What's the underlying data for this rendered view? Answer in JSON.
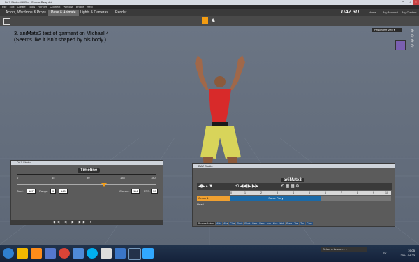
{
  "window": {
    "title": "DAZ Studio 4.6 Pro - Soccer Parry.duf"
  },
  "menu": [
    "File",
    "Edit",
    "Create",
    "Tools",
    "Render",
    "Connect",
    "Window",
    "Bridge",
    "Help"
  ],
  "tabs": [
    "Actors, Wardrobe & Props",
    "Pose & Animate",
    "Lights & Cameras",
    "Render"
  ],
  "active_tab": "Pose & Animate",
  "brand": "DAZ 3D",
  "top_links": [
    "Home",
    "My Account",
    "My Content"
  ],
  "annotation": {
    "line1": "3. aniMate2 test of garment on Michael 4",
    "line2": "(Seems like it isn´t shaped by his body.)"
  },
  "viewport": {
    "camera_label": "Perspective View"
  },
  "timeline_window": {
    "title": "DAZ Studio",
    "panel_title": "Timeline",
    "ruler_ticks": [
      "0",
      "45",
      "90",
      "135",
      "180"
    ],
    "fields": [
      {
        "label": "Total:",
        "value": "187"
      },
      {
        "label": "Range:",
        "value": "0"
      },
      {
        "label": "",
        "value": "140"
      },
      {
        "label": "Current:",
        "value": "114"
      },
      {
        "label": "FPS:",
        "value": "30"
      }
    ]
  },
  "animate_window": {
    "title": "DAZ Studio",
    "panel_title": "aniMate2",
    "ruler_ticks": [
      "0",
      "1",
      "2",
      "3",
      "4",
      "5",
      "6",
      "7",
      "8",
      "9",
      "10"
    ],
    "track_name": "Group 1",
    "track_row2_label": "Head",
    "block_label": "Force Parry",
    "bottom_tabs": [
      "Browse Anims",
      "Ahla",
      "Aha",
      "Clas",
      "Rock",
      "Rock",
      "Fem",
      "New",
      "Jum",
      "Kick",
      "Kick",
      "Pose",
      "The",
      "The",
      "Com"
    ]
  },
  "taskbar": {
    "lesson_select": "Select a Lesson...",
    "time": "19:05",
    "date": "2014-04-23",
    "lang": "SV"
  },
  "colors": {
    "accent_orange": "#f39c12",
    "track_blue": "#1b6aa8",
    "track_orange": "#f0a030",
    "viewport": "#657080"
  }
}
